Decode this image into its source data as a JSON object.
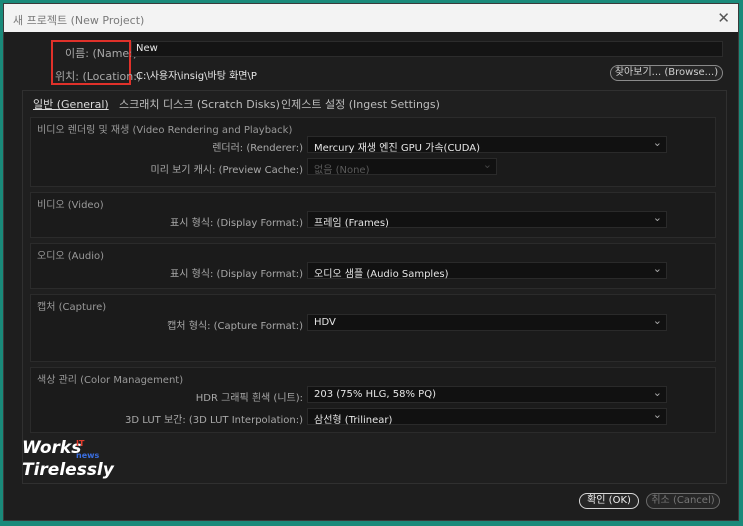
{
  "window": {
    "title": "새 프로젝트 (New Project)"
  },
  "header": {
    "name_label": "이름: (Name:)",
    "name_value": "New",
    "location_label": "위치: (Location:)",
    "location_value": "C:\\사용자\\insig\\바탕 화면\\P",
    "browse_label": "찾아보기... (Browse...)"
  },
  "tabs": [
    {
      "label": "일반 (General)",
      "active": true
    },
    {
      "label": "스크래치 디스크 (Scratch Disks)",
      "active": false
    },
    {
      "label": "인제스트 설정 (Ingest Settings)",
      "active": false
    }
  ],
  "video_rendering": {
    "title": "비디오 렌더링 및 재생 (Video Rendering and Playback)",
    "renderer_label": "렌더러: (Renderer:)",
    "renderer_value": "Mercury 재생 엔진 GPU 가속(CUDA)",
    "preview_cache_label": "미리 보기 캐시: (Preview Cache:)",
    "preview_cache_value": "없음 (None)"
  },
  "video": {
    "title": "비디오 (Video)",
    "display_format_label": "표시 형식: (Display Format:)",
    "display_format_value": "프레임 (Frames)"
  },
  "audio": {
    "title": "오디오 (Audio)",
    "display_format_label": "표시 형식: (Display Format:)",
    "display_format_value": "오디오 샘플 (Audio Samples)"
  },
  "capture": {
    "title": "캡처 (Capture)",
    "capture_format_label": "캡처 형식: (Capture Format:)",
    "capture_format_value": "HDV"
  },
  "color": {
    "title": "색상 관리 (Color Management)",
    "hdr_label": "HDR 그래픽 흰색 (니트):",
    "hdr_value": "203 (75% HLG, 58% PQ)",
    "lut_label": "3D LUT 보간: (3D LUT Interpolation:)",
    "lut_value": "삼선형 (Trilinear)"
  },
  "footer": {
    "ok_label": "확인 (OK)",
    "cancel_label": "취소 (Cancel)"
  },
  "watermark": {
    "line1": "Works",
    "line2": "Tirelessly",
    "tag_it": "IT",
    "tag_news": "news"
  },
  "colors": {
    "accent_highlight": "#e0312a",
    "background": "#1e1e1e",
    "frame": "#1a8a7a"
  }
}
